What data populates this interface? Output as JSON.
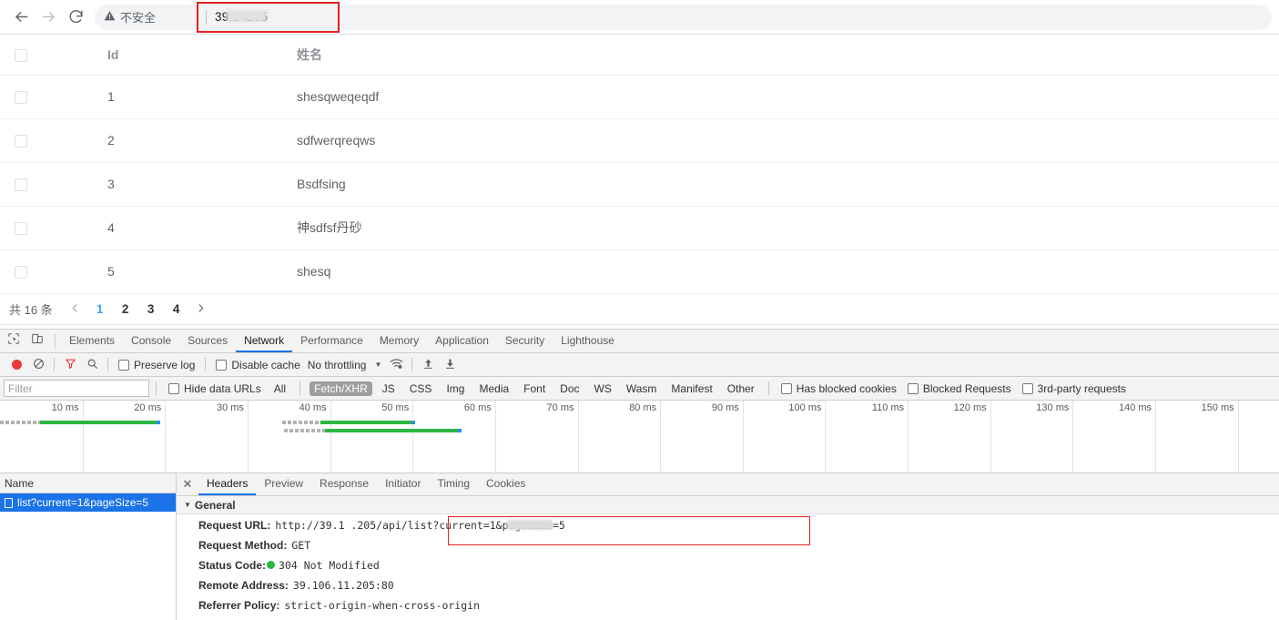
{
  "browser": {
    "back_icon": "back-arrow-icon",
    "forward_icon": "forward-arrow-icon",
    "reload_icon": "reload-icon",
    "security_label": "不安全",
    "url_value": "39.1       .205",
    "url_prefix": "39.1",
    "url_suffix": ".205",
    "highlight_color": "#e02020"
  },
  "page": {
    "table": {
      "columns": [
        "",
        "Id",
        "姓名"
      ],
      "rows": [
        {
          "id": "1",
          "name": "shesqweqeqdf"
        },
        {
          "id": "2",
          "name": "sdfwerqreqws"
        },
        {
          "id": "3",
          "name": "Bsdfsing"
        },
        {
          "id": "4",
          "name": "神sdfsf丹砂"
        },
        {
          "id": "5",
          "name": "shesq"
        }
      ]
    },
    "pagination": {
      "total_label": "共 16 条",
      "prev_icon": "chevron-left-icon",
      "next_icon": "chevron-right-icon",
      "pages": [
        "1",
        "2",
        "3",
        "4"
      ],
      "active_page": "1",
      "active_color": "#409eff"
    }
  },
  "devtools": {
    "inspect_icon": "inspect-element-icon",
    "device_icon": "device-toolbar-icon",
    "tabs": [
      "Elements",
      "Console",
      "Sources",
      "Network",
      "Performance",
      "Memory",
      "Application",
      "Security",
      "Lighthouse"
    ],
    "active_tab": "Network",
    "active_color": "#1a73e8",
    "toolbar": {
      "record_icon": "record-stop-icon",
      "clear_icon": "clear-icon",
      "filter_icon": "filter-funnel-icon",
      "search_icon": "search-icon",
      "preserve_log_label": "Preserve log",
      "preserve_log_checked": false,
      "disable_cache_label": "Disable cache",
      "disable_cache_checked": false,
      "throttling_value": "No throttling",
      "throttling_caret_icon": "chevron-down-icon",
      "wifi_icon": "network-conditions-icon",
      "import_icon": "import-har-icon",
      "export_icon": "export-har-icon"
    },
    "filters": {
      "filter_placeholder": "Filter",
      "filter_value": "",
      "hide_data_urls_label": "Hide data URLs",
      "hide_data_urls_checked": false,
      "types": [
        "All",
        "Fetch/XHR",
        "JS",
        "CSS",
        "Img",
        "Media",
        "Font",
        "Doc",
        "WS",
        "Wasm",
        "Manifest",
        "Other"
      ],
      "active_type": "Fetch/XHR",
      "has_blocked_cookies_label": "Has blocked cookies",
      "has_blocked_cookies_checked": false,
      "blocked_requests_label": "Blocked Requests",
      "blocked_requests_checked": false,
      "third_party_label": "3rd-party requests",
      "third_party_checked": false
    },
    "overview": {
      "tick_labels": [
        "10 ms",
        "20 ms",
        "30 ms",
        "40 ms",
        "50 ms",
        "60 ms",
        "70 ms",
        "80 ms",
        "90 ms",
        "100 ms",
        "110 ms",
        "120 ms",
        "130 ms",
        "140 ms",
        "150 ms"
      ],
      "bars": [
        {
          "wait_start": 0,
          "wait_width": 44,
          "dl_start": 44,
          "dl_end": 172,
          "row": 0
        },
        {
          "wait_start": 310,
          "wait_width": 42,
          "dl_start": 352,
          "dl_end": 452,
          "row": 0
        },
        {
          "wait_start": 312,
          "wait_width": 45,
          "dl_start": 357,
          "dl_end": 503,
          "row": 1
        }
      ]
    },
    "requests": {
      "name_column_header": "Name",
      "rows": [
        {
          "name": "list?current=1&pageSize=5",
          "selected": true,
          "icon": "document-icon"
        }
      ],
      "selected_color": "#1a73e8"
    },
    "details": {
      "close_icon": "close-icon",
      "tabs": [
        "Headers",
        "Preview",
        "Response",
        "Initiator",
        "Timing",
        "Cookies"
      ],
      "active_tab": "Headers",
      "general_section_label": "General",
      "general_caret_icon": "triangle-down-icon",
      "general": [
        {
          "key": "Request URL:",
          "value": "http://39.1       .205/api/list?current=1&pageSize=5",
          "highlighted": true
        },
        {
          "key": "Request Method:",
          "value": "GET",
          "highlighted": false
        },
        {
          "key": "Status Code:",
          "value": "304 Not Modified",
          "status_dot": "#2db742",
          "highlighted": false
        },
        {
          "key": "Remote Address:",
          "value": "39.106.11.205:80",
          "highlighted": false
        },
        {
          "key": "Referrer Policy:",
          "value": "strict-origin-when-cross-origin",
          "highlighted": false
        }
      ]
    }
  }
}
